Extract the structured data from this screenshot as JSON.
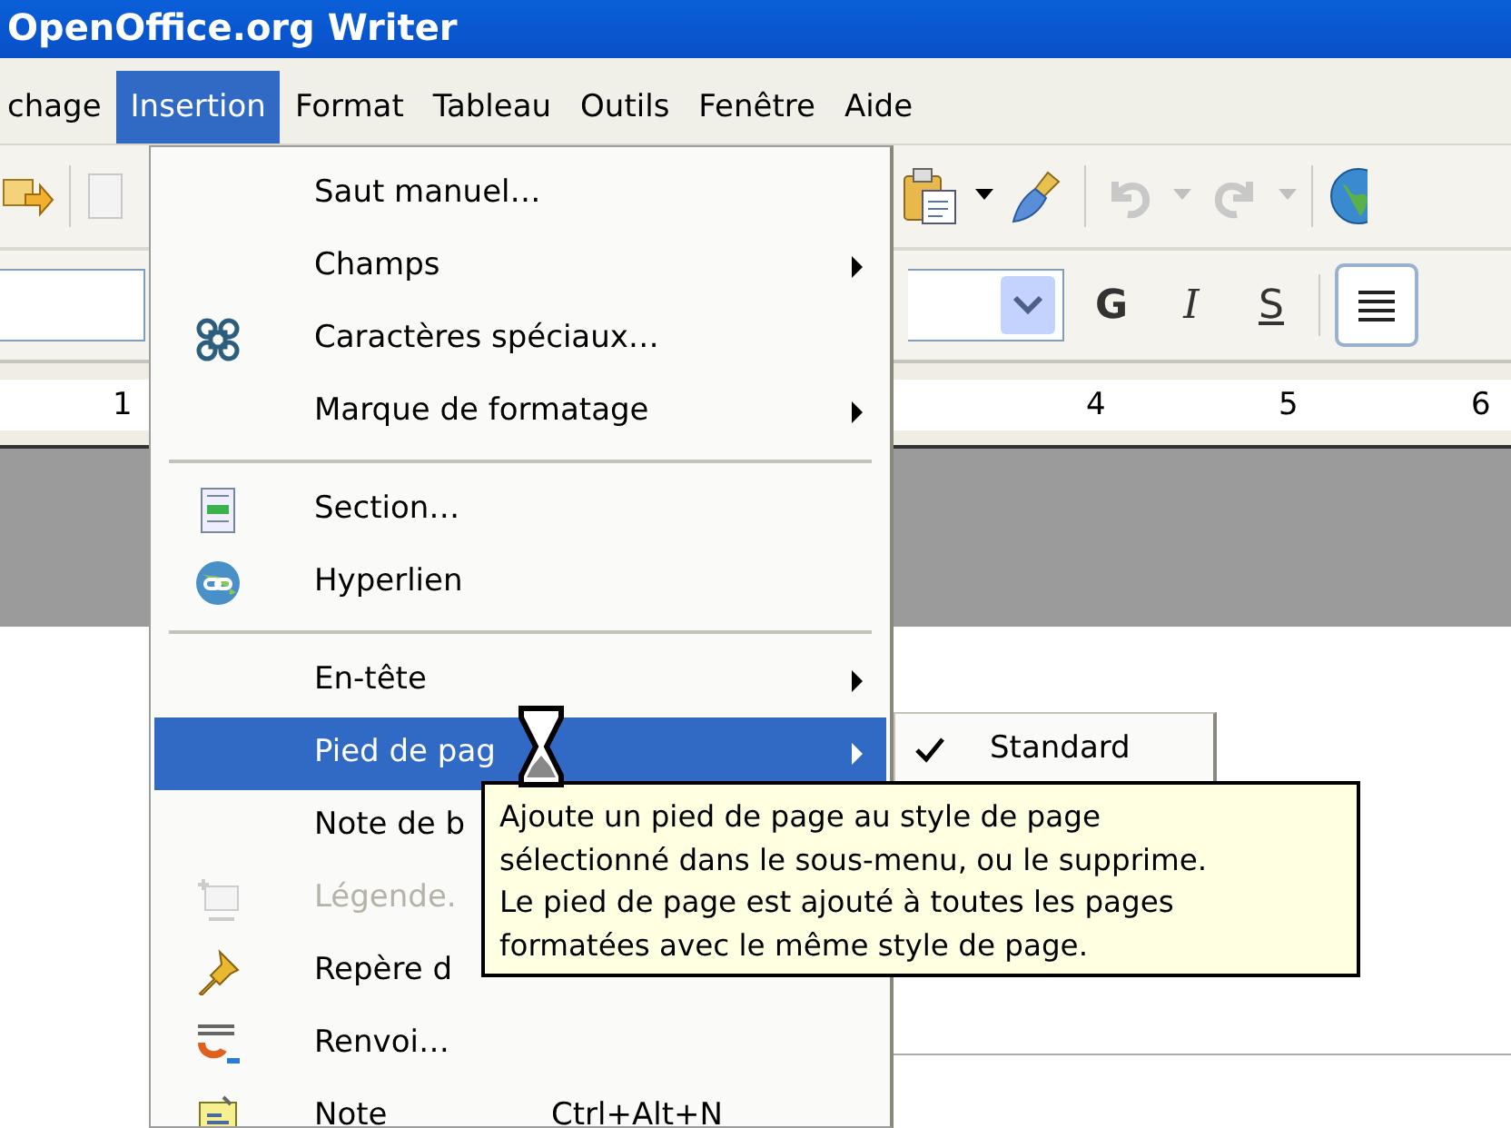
{
  "window": {
    "title": "OpenOffice.org Writer"
  },
  "menu_bar": [
    {
      "label": "chage",
      "selected": false
    },
    {
      "label": "Insertion",
      "selected": true
    },
    {
      "label": "Format",
      "selected": false
    },
    {
      "label": "Tableau",
      "selected": false
    },
    {
      "label": "Outils",
      "selected": false
    },
    {
      "label": "Fenêtre",
      "selected": false
    },
    {
      "label": "Aide",
      "selected": false
    }
  ],
  "format_toolbar": {
    "bold": "G",
    "italic": "I",
    "underline": "S"
  },
  "ruler": {
    "left_label": "1",
    "right_labels": [
      "4",
      "5",
      "6"
    ]
  },
  "menu": {
    "items": [
      {
        "kind": "item",
        "label": "Saut manuel…",
        "submenu": false,
        "disabled": false,
        "selected": false
      },
      {
        "kind": "item",
        "label": "Champs",
        "submenu": true,
        "disabled": false,
        "selected": false
      },
      {
        "kind": "item",
        "label": "Caractères spéciaux…",
        "submenu": false,
        "disabled": false,
        "selected": false
      },
      {
        "kind": "item",
        "label": "Marque de formatage",
        "submenu": true,
        "disabled": false,
        "selected": false
      },
      {
        "kind": "separator"
      },
      {
        "kind": "item",
        "label": "Section…",
        "submenu": false,
        "disabled": false,
        "selected": false
      },
      {
        "kind": "item",
        "label": "Hyperlien",
        "submenu": false,
        "disabled": false,
        "selected": false
      },
      {
        "kind": "separator"
      },
      {
        "kind": "item",
        "label": "En-tête",
        "submenu": true,
        "disabled": false,
        "selected": false
      },
      {
        "kind": "item",
        "label": "Pied de pag",
        "submenu": true,
        "disabled": false,
        "selected": true
      },
      {
        "kind": "item",
        "label": "Note de b",
        "submenu": false,
        "disabled": false,
        "selected": false
      },
      {
        "kind": "item",
        "label": "Légende.",
        "submenu": false,
        "disabled": true,
        "selected": false
      },
      {
        "kind": "item",
        "label": "Repère d",
        "submenu": false,
        "disabled": false,
        "selected": false
      },
      {
        "kind": "item",
        "label": "Renvoi…",
        "submenu": false,
        "disabled": false,
        "selected": false
      },
      {
        "kind": "item",
        "label": "Note",
        "submenu": false,
        "disabled": false,
        "selected": false,
        "shortcut": "Ctrl+Alt+N"
      }
    ]
  },
  "submenu": {
    "items": [
      {
        "label": "Standard",
        "checked": true
      }
    ]
  },
  "tooltip": {
    "text": "Ajoute un pied de page au style de page\nsélectionné dans le sous-menu, ou le supprime.\nLe pied de page est ajouté à toutes les pages\nformatées avec le même style de page."
  }
}
